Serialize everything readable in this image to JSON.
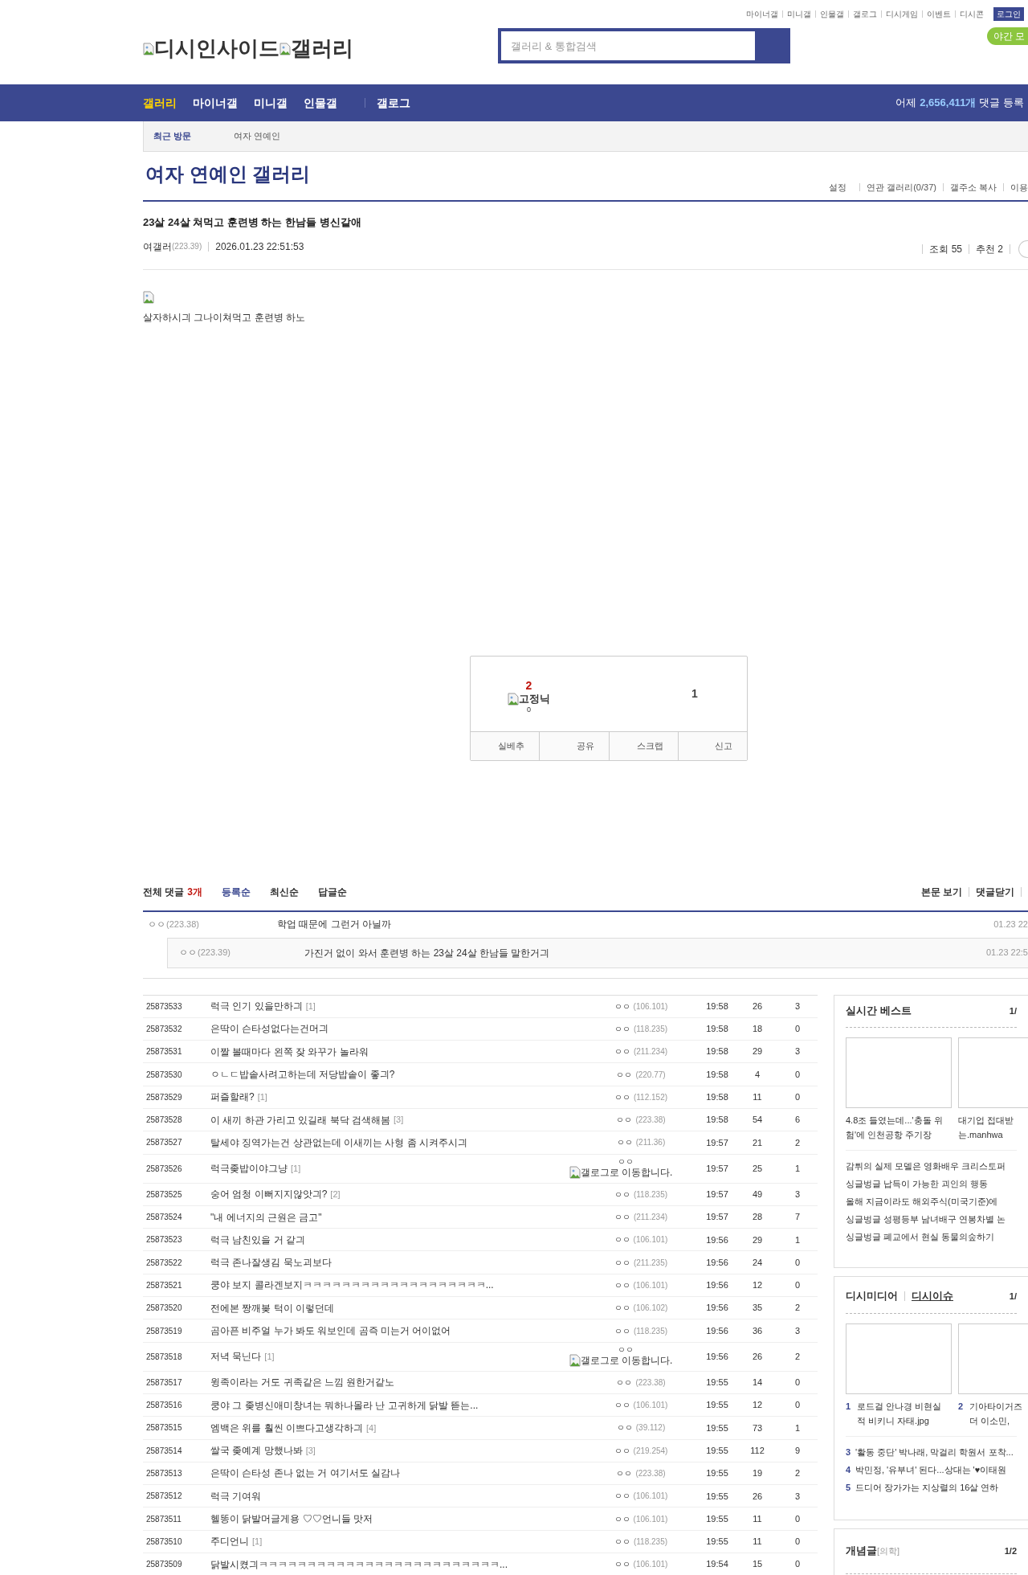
{
  "top_links": [
    "마이너갤",
    "미니갤",
    "인물갤",
    "갤로그",
    "디시게임",
    "이벤트",
    "디시콘"
  ],
  "login_button": "로그인",
  "night_mode": "야간 모",
  "logo": {
    "site": "디시인사이드",
    "section": "갤러리"
  },
  "search": {
    "placeholder": "갤러리 & 통합검색"
  },
  "nav": [
    {
      "label": "갤러리",
      "selected": true
    },
    {
      "label": "마이너갤",
      "selected": false
    },
    {
      "label": "미니갤",
      "selected": false
    },
    {
      "label": "인물갤",
      "selected": false
    },
    {
      "label": "갤로그",
      "selected": false
    }
  ],
  "nav_stat": {
    "prefix": "어제",
    "count": "2,656,411개",
    "suffix": "댓글 등록"
  },
  "recent": {
    "label": "최근 방문",
    "items": [
      "여자 연예인"
    ]
  },
  "gallery_title": "여자 연예인 갤러리",
  "gallery_links": [
    "설정",
    "연관 갤러리(0/37)",
    "갤주소 복사",
    "이용"
  ],
  "post": {
    "title": "23살 24살 쳐먹고 훈련병 하는 한남들 병신같애",
    "author": "여갤러",
    "ip": "(223.39)",
    "date": "2026.01.23 22:51:53",
    "views": "조회 55",
    "recommend": "추천 2",
    "body": "살자하시긔 그나이쳐먹고 훈련병 하노"
  },
  "vote": {
    "up": "2",
    "nick_label": "고정닉",
    "nick_count": "0",
    "down": "1",
    "buttons": [
      "실베추",
      "공유",
      "스크랩",
      "신고"
    ]
  },
  "comments": {
    "label": "전체 댓글",
    "count": "3개",
    "sorts": [
      {
        "label": "등록순",
        "selected": true
      },
      {
        "label": "최신순",
        "selected": false
      },
      {
        "label": "답글순",
        "selected": false
      }
    ],
    "links": [
      "본문 보기",
      "댓글닫기"
    ],
    "items": [
      {
        "nick": "ㅇㅇ",
        "ip": "(223.38)",
        "text": "학업 때문에 그런거 아닐까",
        "date": "01.23 22",
        "children": [
          {
            "nick": "ㅇㅇ",
            "ip": "(223.39)",
            "text": "가진거 없이 와서 훈련병 하는 23살 24살 한남들 말한거긔",
            "date": "01.23 22:5"
          }
        ]
      }
    ]
  },
  "list": [
    {
      "num": "25873533",
      "title": "럭극 인기 있을만하긔",
      "replies": "[1]",
      "kind": "ip",
      "nick": "ㅇㅇ",
      "ip": "(106.101)",
      "time": "19:58",
      "views": "26",
      "recs": "3"
    },
    {
      "num": "25873532",
      "title": "은딱이 슨타성없다는건머긔",
      "kind": "ip",
      "nick": "ㅇㅇ",
      "ip": "(118.235)",
      "time": "19:58",
      "views": "18",
      "recs": "0"
    },
    {
      "num": "25873531",
      "title": "이짤 볼때마다 왼쪽 잦 와꾸가 놀라워",
      "kind": "ip",
      "nick": "ㅇㅇ",
      "ip": "(211.234)",
      "time": "19:58",
      "views": "29",
      "recs": "3"
    },
    {
      "num": "25873530",
      "title": "ㅇㄴㄷ밥솥사려고하는데 저당밥솥이 좋긔?",
      "kind": "ip",
      "nick": "ㅇㅇ",
      "ip": "(220.77)",
      "time": "19:58",
      "views": "4",
      "recs": "0"
    },
    {
      "num": "25873529",
      "title": "퍼즐할래?",
      "replies": "[1]",
      "kind": "ip",
      "nick": "ㅇㅇ",
      "ip": "(112.152)",
      "time": "19:58",
      "views": "11",
      "recs": "0"
    },
    {
      "num": "25873528",
      "title": "이 새끼 하관 가리고 있길래 북닥 검색해봄",
      "replies": "[3]",
      "kind": "ip",
      "nick": "ㅇㅇ",
      "ip": "(223.38)",
      "time": "19:58",
      "views": "54",
      "recs": "6"
    },
    {
      "num": "25873527",
      "title": "탈세야 징역가는건 상관없는데 이새끼는 사형 좀 시켜주시긔",
      "kind": "ip",
      "nick": "ㅇㅇ",
      "ip": "(211.36)",
      "time": "19:57",
      "views": "21",
      "recs": "2"
    },
    {
      "num": "25873526",
      "title": "럭극좆밥이야그냥",
      "replies": "[1]",
      "kind": "gallog",
      "nick": "ㅇㅇ",
      "alt": "갤로그로 이동합니다.",
      "time": "19:57",
      "views": "25",
      "recs": "1"
    },
    {
      "num": "25873525",
      "title": "숭어 엄청 이뻐지지않앗긔?",
      "replies": "[2]",
      "kind": "ip",
      "nick": "ㅇㅇ",
      "ip": "(118.235)",
      "time": "19:57",
      "views": "49",
      "recs": "3"
    },
    {
      "num": "25873524",
      "title": "\"내 에너지의 근원은 금고\"",
      "kind": "ip",
      "nick": "ㅇㅇ",
      "ip": "(211.234)",
      "time": "19:57",
      "views": "28",
      "recs": "7"
    },
    {
      "num": "25873523",
      "title": "럭극 남친있을 거 같긔",
      "kind": "ip",
      "nick": "ㅇㅇ",
      "ip": "(106.101)",
      "time": "19:56",
      "views": "29",
      "recs": "1"
    },
    {
      "num": "25873522",
      "title": "럭극 존나잘생김 묵노괴보다",
      "kind": "ip",
      "nick": "ㅇㅇ",
      "ip": "(211.235)",
      "time": "19:56",
      "views": "24",
      "recs": "0"
    },
    {
      "num": "25873521",
      "title": "쿵야 보지 콜라겐보지ㅋㅋㅋㅋㅋㅋㅋㅋㅋㅋㅋㅋㅋㅋㅋㅋㅋㅋㅋ...",
      "kind": "ip",
      "nick": "ㅇㅇ",
      "ip": "(106.101)",
      "time": "19:56",
      "views": "12",
      "recs": "0"
    },
    {
      "num": "25873520",
      "title": "전에본 짱깨봊 턱이 이렇던데",
      "kind": "ip",
      "nick": "ㅇㅇ",
      "ip": "(106.102)",
      "time": "19:56",
      "views": "35",
      "recs": "2"
    },
    {
      "num": "25873519",
      "title": "곰아픈 비주얼 누가 봐도 워보인데 곰즉 미는거 어이없어",
      "kind": "ip",
      "nick": "ㅇㅇ",
      "ip": "(118.235)",
      "time": "19:56",
      "views": "36",
      "recs": "3"
    },
    {
      "num": "25873518",
      "title": "저녁 묵닌다",
      "replies": "[1]",
      "kind": "gallog",
      "nick": "ㅇㅇ",
      "alt": "갤로그로 이동합니다.",
      "time": "19:56",
      "views": "26",
      "recs": "2"
    },
    {
      "num": "25873517",
      "title": "윙족이라는 거도 귀족같은 느낌 원한거같노",
      "kind": "ip",
      "nick": "ㅇㅇ",
      "ip": "(223.38)",
      "time": "19:55",
      "views": "14",
      "recs": "0"
    },
    {
      "num": "25873516",
      "title": "쿵야 그 좆병신애미창녀는 뭐하나몰라 난 고귀하게 닭발 뜯는...",
      "kind": "ip",
      "nick": "ㅇㅇ",
      "ip": "(106.101)",
      "time": "19:55",
      "views": "12",
      "recs": "0"
    },
    {
      "num": "25873515",
      "title": "엠백은 위를 훨씬 이쁘다고생각하긔",
      "replies": "[4]",
      "kind": "ip",
      "nick": "ㅇㅇ",
      "ip": "(39.112)",
      "time": "19:55",
      "views": "73",
      "recs": "1"
    },
    {
      "num": "25873514",
      "title": "쌀국 좆예계 망했나봐",
      "replies": "[3]",
      "kind": "ip",
      "nick": "ㅇㅇ",
      "ip": "(219.254)",
      "time": "19:55",
      "views": "112",
      "recs": "9"
    },
    {
      "num": "25873513",
      "title": "은딱이 슨타성 존나 없는 거 여기서도 실감나",
      "kind": "ip",
      "nick": "ㅇㅇ",
      "ip": "(223.38)",
      "time": "19:55",
      "views": "19",
      "recs": "2"
    },
    {
      "num": "25873512",
      "title": "럭극 기여워",
      "kind": "ip",
      "nick": "ㅇㅇ",
      "ip": "(106.101)",
      "time": "19:55",
      "views": "26",
      "recs": "3"
    },
    {
      "num": "25873511",
      "title": "헬똥이 닭발머글게용 ♡♡언니들 맛저",
      "kind": "ip",
      "nick": "ㅇㅇ",
      "ip": "(106.101)",
      "time": "19:55",
      "views": "11",
      "recs": "0"
    },
    {
      "num": "25873510",
      "title": "주디언니",
      "replies": "[1]",
      "kind": "ip",
      "nick": "ㅇㅇ",
      "ip": "(118.235)",
      "time": "19:55",
      "views": "11",
      "recs": "0"
    },
    {
      "num": "25873509",
      "title": "닭발시켰긔ㅋㅋㅋㅋㅋㅋㅋㅋㅋㅋㅋㅋㅋㅋㅋㅋㅋㅋㅋㅋㅋㅋㅋㅋㅋ...",
      "kind": "ip",
      "nick": "ㅇㅇ",
      "ip": "(106.101)",
      "time": "19:54",
      "views": "15",
      "recs": "0"
    }
  ],
  "sidebar": {
    "best": {
      "title": "실시간 베스트",
      "page": "1/",
      "cards": [
        "4.8조 들였는데...'충돌 위험'에 인천공항 주기장",
        "대기업 접대받 는.manhwa"
      ],
      "items": [
        "감튀의 실제 모델은 영화배우 크리스토퍼",
        "싱글벙글 납득이 가능한 괴인의 행동",
        "올해 지금이라도 해외주식(미국기준)에",
        "싱글벙글 성평등부 남녀배구 연봉차별 논",
        "싱글벙글 폐교에서 현실 동물의숲하기"
      ]
    },
    "media": {
      "tabs": [
        {
          "label": "디시미디어",
          "selected": false
        },
        {
          "label": "디시이슈",
          "selected": true
        }
      ],
      "page": "1/",
      "cards": [
        {
          "rank": "1",
          "text": "로드걸 안나경 비현실 적 비키니 자태.jpg"
        },
        {
          "rank": "2",
          "text": "기아타이거즈 더 이소민,"
        }
      ],
      "items": [
        {
          "rank": "3",
          "text": "'활동 중단' 박나래, 막걸리 학원서 포착..."
        },
        {
          "rank": "4",
          "text": "박민정, '유부녀' 된다...상대는 '♥이태원"
        },
        {
          "rank": "5",
          "text": "드디어 장가가는 지상렬의 16살 연하"
        }
      ]
    },
    "concept": {
      "title": "개념글",
      "tag": "[의학]",
      "page": "1/2"
    }
  }
}
